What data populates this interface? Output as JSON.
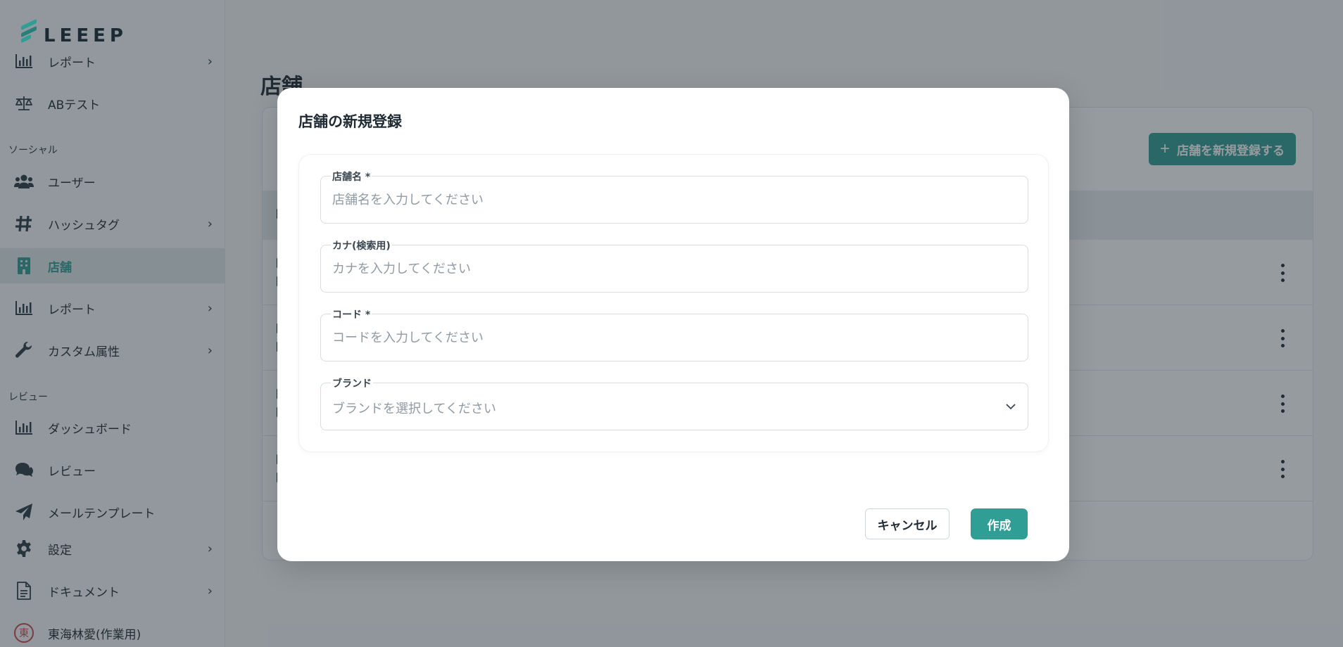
{
  "app": {
    "logo_text": "LEEEP",
    "accent_color": "#2f9e94"
  },
  "sidebar": {
    "top_items": [
      {
        "label": "レポート",
        "icon": "bar-chart-icon"
      },
      {
        "label": "ABテスト",
        "icon": "scale-icon"
      }
    ],
    "section_social": "ソーシャル",
    "social_items": [
      {
        "label": "ユーザー",
        "icon": "users-icon"
      },
      {
        "label": "ハッシュタグ",
        "icon": "hashtag-icon"
      },
      {
        "label": "店舗",
        "icon": "building-icon",
        "active": true
      },
      {
        "label": "レポート",
        "icon": "bar-chart-icon"
      },
      {
        "label": "カスタム属性",
        "icon": "wrench-icon"
      }
    ],
    "section_review": "レビュー",
    "review_items": [
      {
        "label": "ダッシュボード",
        "icon": "bar-chart-icon"
      },
      {
        "label": "レビュー",
        "icon": "comments-icon"
      },
      {
        "label": "メールテンプレート",
        "icon": "paper-plane-icon"
      }
    ],
    "bottom_items": [
      {
        "label": "設定",
        "icon": "gear-icon"
      },
      {
        "label": "ドキュメント",
        "icon": "document-icon"
      }
    ],
    "user": {
      "avatar_char": "東",
      "name": "東海林愛(作業用)"
    }
  },
  "page": {
    "title": "店舗",
    "add_button": "店舗を新規登録する"
  },
  "modal": {
    "title": "店舗の新規登録",
    "fields": {
      "name": {
        "label": "店舗名 *",
        "placeholder": "店舗名を入力してください"
      },
      "kana": {
        "label": "カナ(検索用)",
        "placeholder": "カナを入力してください"
      },
      "code": {
        "label": "コード *",
        "placeholder": "コードを入力してください"
      },
      "brand": {
        "label": "ブランド",
        "placeholder": "ブランドを選択してください"
      }
    },
    "cancel_label": "キャンセル",
    "create_label": "作成"
  }
}
